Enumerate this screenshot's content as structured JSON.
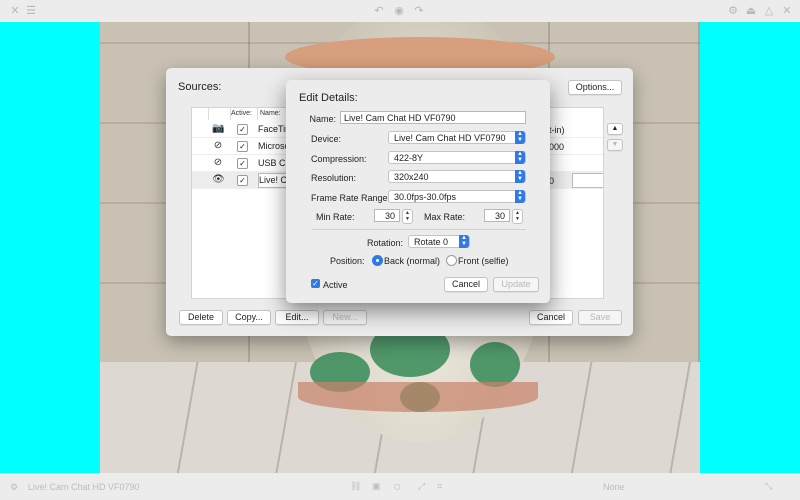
{
  "toolbar_top": {
    "icons": [
      "rotate-left-icon",
      "camera-mask-icon",
      "rotate-right-icon",
      "options-icon",
      "eject-icon",
      "triangle-icon",
      "close-icon",
      "menu-icon"
    ]
  },
  "sources_dialog": {
    "title": "Sources:",
    "options_button": "Options...",
    "columns": {
      "active": "Active:",
      "name": "Name:"
    },
    "rows": [
      {
        "icon": "camera-icon",
        "active": "✓",
        "name": "FaceTim",
        "extra": "t-in)"
      },
      {
        "icon": "disabled-icon",
        "active": "✓",
        "name": "Microso",
        "extra": "000"
      },
      {
        "icon": "disabled-icon",
        "active": "✓",
        "name": "USB Ca",
        "extra": ""
      },
      {
        "icon": "eye-icon",
        "active": "✓",
        "name": "Live! Ca",
        "extra": "0"
      }
    ],
    "buttons": {
      "delete": "Delete",
      "copy": "Copy...",
      "edit": "Edit...",
      "new": "New...",
      "cancel": "Cancel",
      "save": "Save"
    }
  },
  "edit_dialog": {
    "title": "Edit Details:",
    "name_label": "Name:",
    "name_value": "Live! Cam Chat HD VF0790",
    "device_label": "Device:",
    "device_value": "Live! Cam Chat HD VF0790",
    "compression_label": "Compression:",
    "compression_value": "422-8Y",
    "resolution_label": "Resolution:",
    "resolution_value": "320x240",
    "frame_rate_label": "Frame Rate Range:",
    "frame_rate_value": "30.0fps-30.0fps",
    "min_rate_label": "Min Rate:",
    "min_rate_value": "30",
    "max_rate_label": "Max Rate:",
    "max_rate_value": "30",
    "rotation_label": "Rotation:",
    "rotation_value": "Rotate 0",
    "position_label": "Position:",
    "position_back": "Back (normal)",
    "position_front": "Front (selfie)",
    "active_label": "Active",
    "cancel_button": "Cancel",
    "update_button": "Update"
  },
  "bottom_bar": {
    "source_name": "Live! Cam Chat HD VF0790",
    "right_label": "None"
  },
  "colors": {
    "accent": "#2f7ae5",
    "backdrop": "#00ffff"
  }
}
